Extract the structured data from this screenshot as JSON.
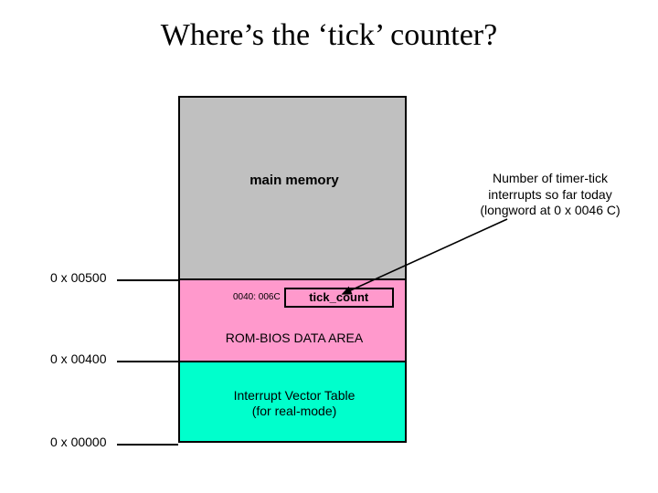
{
  "title": "Where’s the ‘tick’ counter?",
  "memory": {
    "main_label": "main memory",
    "bios_label": "ROM-BIOS DATA AREA",
    "ivt_label_line1": "Interrupt Vector Table",
    "ivt_label_line2": "(for real-mode)",
    "tick_count_addr": "0040: 006C",
    "tick_count_label": "tick_count"
  },
  "note": {
    "line1": "Number of timer-tick",
    "line2": "interrupts so far today",
    "line3": "(longword at 0 x 0046 C)"
  },
  "addresses": {
    "a1": "0 x 00500",
    "a2": "0 x 00400",
    "a3": "0 x 00000"
  }
}
